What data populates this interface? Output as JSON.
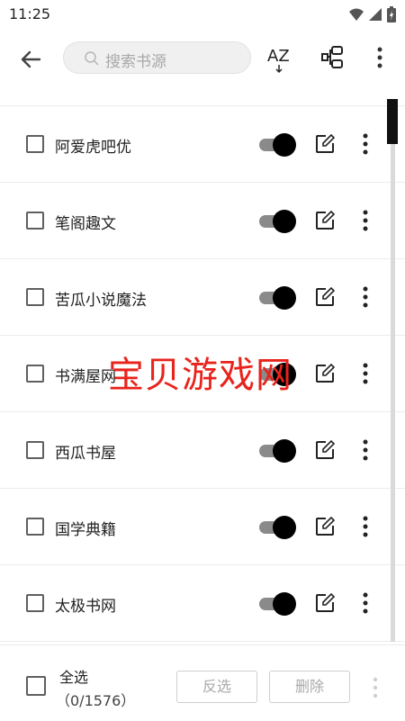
{
  "status": {
    "time": "11:25"
  },
  "toolbar": {
    "search_placeholder": "搜索书源",
    "sort_label": "AZ"
  },
  "sources": [
    {
      "name": "阿爱虎吧优",
      "enabled": true
    },
    {
      "name": "笔阁趣文",
      "enabled": true
    },
    {
      "name": "苦瓜小说魔法",
      "enabled": true
    },
    {
      "name": "书满屋网",
      "enabled": true
    },
    {
      "name": "西瓜书屋",
      "enabled": true
    },
    {
      "name": "国学典籍",
      "enabled": true
    },
    {
      "name": "太极书网",
      "enabled": true
    }
  ],
  "bottom": {
    "select_all_label": "全选",
    "count_label": "（0/1576）",
    "invert_label": "反选",
    "delete_label": "删除"
  },
  "watermark": "宝贝游戏网",
  "colors": {
    "accent_switch": "#000000",
    "track": "#8a8a8a",
    "watermark": "#e8231c"
  }
}
